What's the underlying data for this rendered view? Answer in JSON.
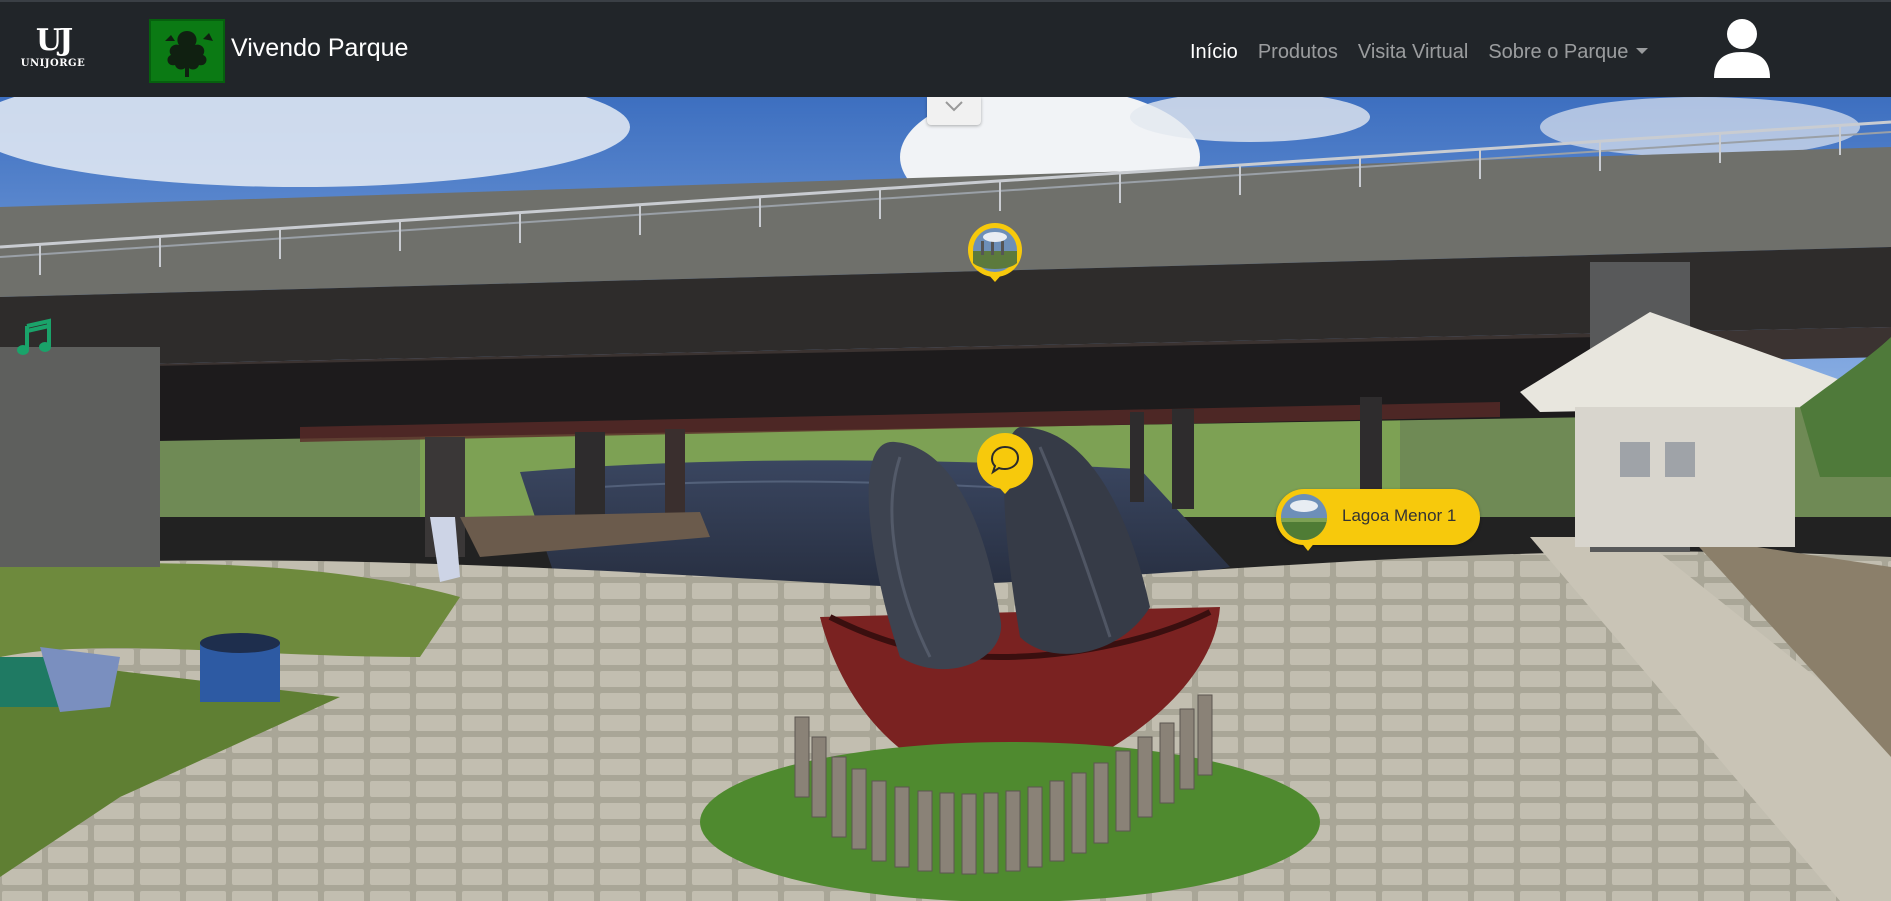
{
  "navbar": {
    "brand_logo_text": "UJ",
    "brand_logo_subtext": "UNIJORGE",
    "site_title": "Vivendo Parque",
    "links": [
      {
        "label": "Início",
        "active": true
      },
      {
        "label": "Produtos",
        "active": false
      },
      {
        "label": "Visita Virtual",
        "active": false
      },
      {
        "label": "Sobre o Parque",
        "active": false,
        "dropdown": true
      }
    ],
    "user_icon": "user-icon"
  },
  "panorama": {
    "hotspots": {
      "scene_link_label": "Lagoa Menor 1",
      "photo_icon": "photo-thumbnail-icon",
      "info_icon": "chat-bubble-icon"
    },
    "music_icon": "music-note-icon",
    "collapse_icon": "chevron-down-icon"
  },
  "colors": {
    "navbar_bg": "#212529",
    "hotspot_yellow": "#f7c90c",
    "music_green": "#1aa36a",
    "park_logo_green": "#0b7a14"
  }
}
